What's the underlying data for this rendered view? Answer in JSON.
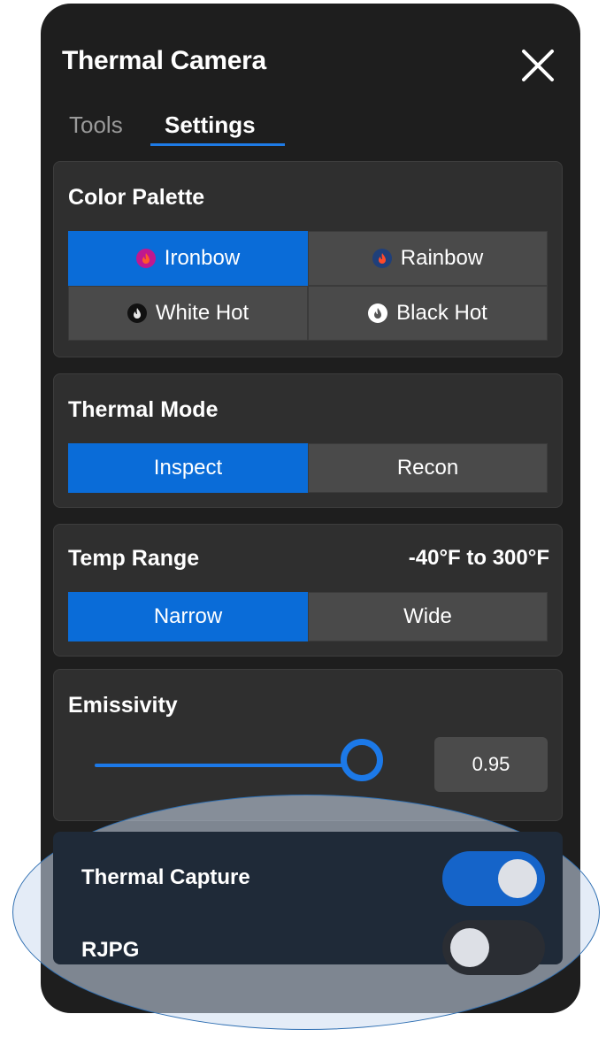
{
  "window": {
    "title": "Thermal Camera"
  },
  "tabs": [
    {
      "label": "Tools",
      "active": false
    },
    {
      "label": "Settings",
      "active": true
    }
  ],
  "color_palette": {
    "title": "Color Palette",
    "options": [
      {
        "label": "Ironbow",
        "icon": "flame-icon",
        "icon_bg": "#c0188f",
        "active": true
      },
      {
        "label": "Rainbow",
        "icon": "flame-icon",
        "icon_bg": "#1f3f7a",
        "active": false
      },
      {
        "label": "White Hot",
        "icon": "flame-icon",
        "icon_bg": "#111111",
        "active": false
      },
      {
        "label": "Black Hot",
        "icon": "flame-icon",
        "icon_bg": "#ffffff",
        "active": false
      }
    ]
  },
  "thermal_mode": {
    "title": "Thermal Mode",
    "options": [
      {
        "label": "Inspect",
        "active": true
      },
      {
        "label": "Recon",
        "active": false
      }
    ]
  },
  "temp_range": {
    "title": "Temp Range",
    "range_text": "-40°F to 300°F",
    "options": [
      {
        "label": "Narrow",
        "active": true
      },
      {
        "label": "Wide",
        "active": false
      }
    ]
  },
  "emissivity": {
    "title": "Emissivity",
    "value": "0.95",
    "slider_level": 0.95
  },
  "thermal_capture": {
    "label": "Thermal Capture",
    "enabled": true
  },
  "rjpg": {
    "label": "RJPG",
    "enabled": false
  },
  "colors": {
    "accent": "#0a6cd8",
    "panel_bg": "#1e1e1e",
    "card_bg": "#2f2f2f"
  }
}
